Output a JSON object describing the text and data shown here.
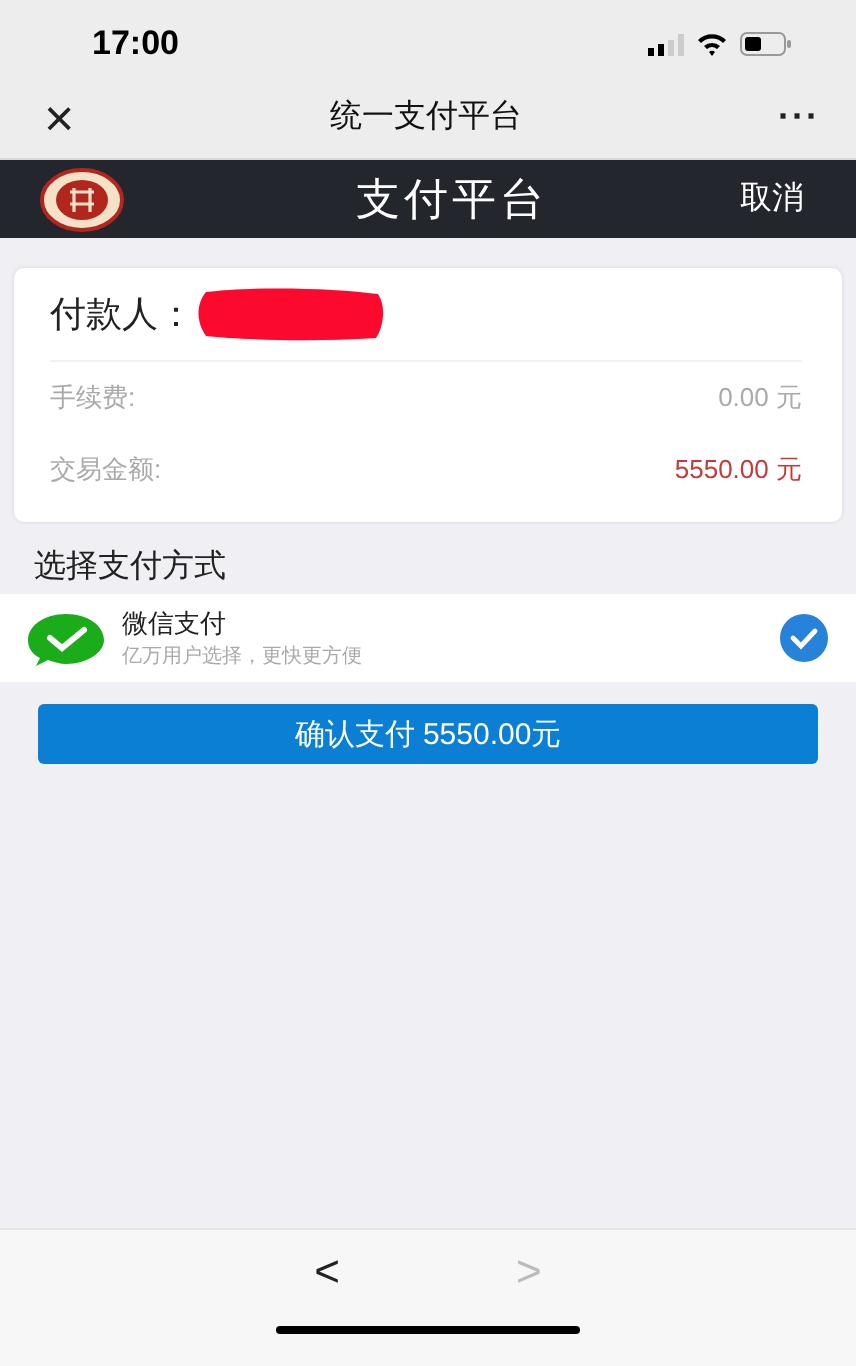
{
  "status_bar": {
    "time": "17:00"
  },
  "browser_bar": {
    "close": "×",
    "title": "统一支付平台",
    "more": "···"
  },
  "header": {
    "title": "支付平台",
    "cancel": "取消"
  },
  "order": {
    "payer_label": "付款人：",
    "payer_redacted": true,
    "rows": [
      {
        "label": "手续费:",
        "amount": "0.00",
        "unit": "元",
        "kind": "plain"
      },
      {
        "label": "交易金额:",
        "amount": "5550.00",
        "unit": "元",
        "kind": "total"
      }
    ]
  },
  "method_section": {
    "title": "选择支付方式"
  },
  "methods": [
    {
      "name": "微信支付",
      "subtitle": "亿万用户选择，更快更方便",
      "selected": true
    }
  ],
  "confirm_button": "确认支付 5550.00元",
  "nav": [
    {
      "glyph": "<",
      "disabled": false
    },
    {
      "glyph": ">",
      "disabled": true
    }
  ]
}
